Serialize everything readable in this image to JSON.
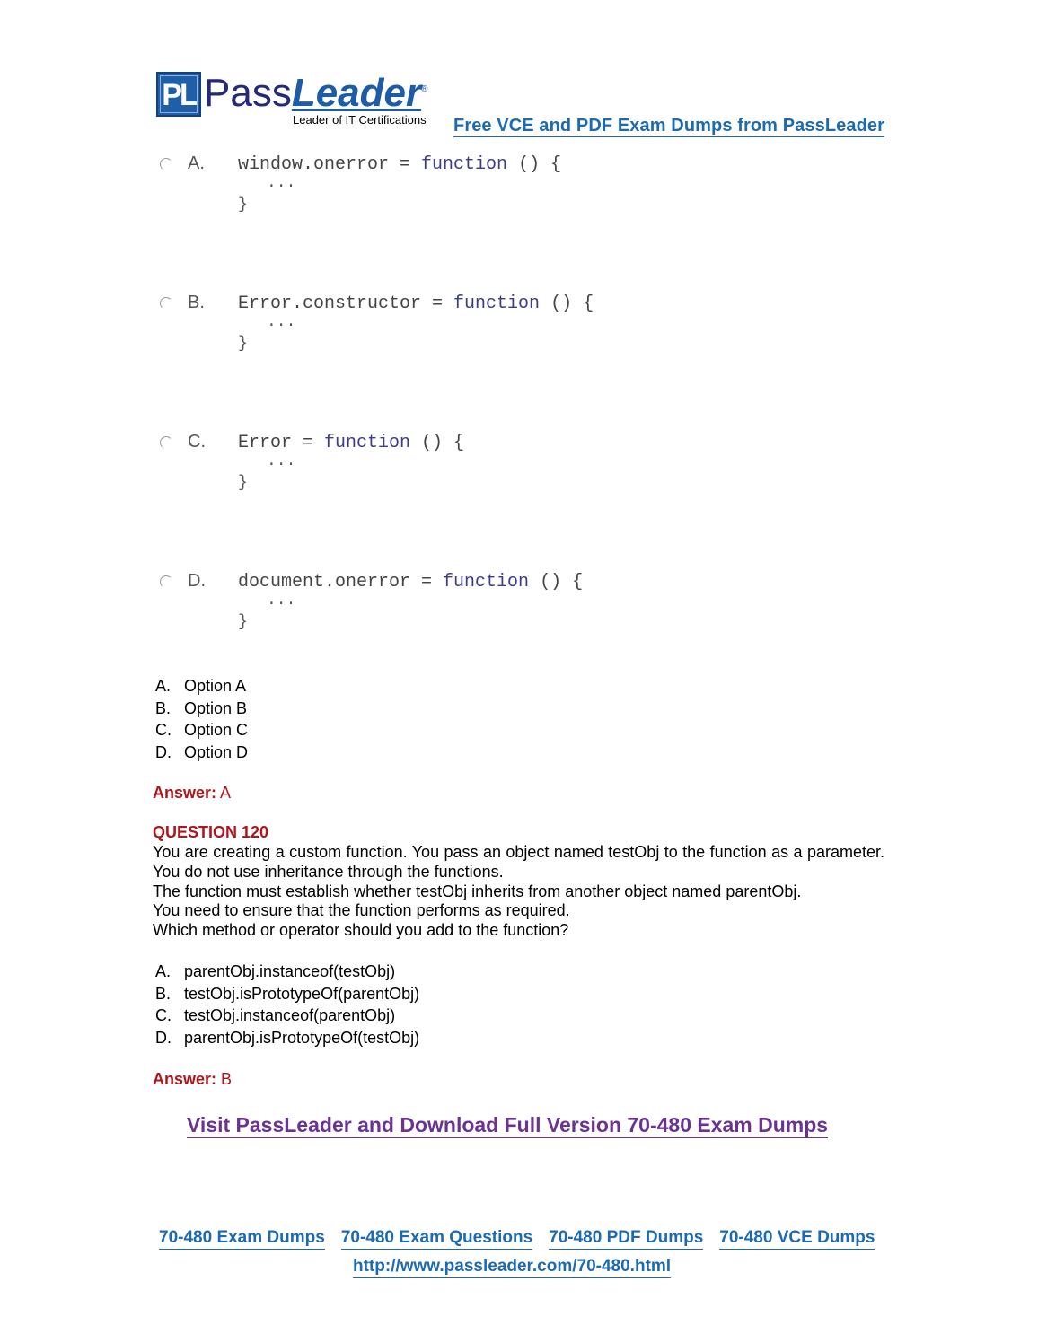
{
  "header": {
    "logo": {
      "box_text": "PL",
      "name_part1": "Pass",
      "name_part2": "Leader",
      "registered": "®",
      "tagline": "Leader of IT Certifications"
    },
    "top_link": "Free VCE and PDF Exam Dumps from PassLeader"
  },
  "question_119": {
    "code_options": [
      {
        "letter": "A.",
        "code_prefix": "window.onerror = ",
        "keyword": "function",
        "code_suffix": " () {",
        "body": "...",
        "close": "}"
      },
      {
        "letter": "B.",
        "code_prefix": "Error.constructor = ",
        "keyword": "function",
        "code_suffix": " () {",
        "body": "...",
        "close": "}"
      },
      {
        "letter": "C.",
        "code_prefix": "Error = ",
        "keyword": "function",
        "code_suffix": " () {",
        "body": "...",
        "close": "}"
      },
      {
        "letter": "D.",
        "code_prefix": "document.onerror = ",
        "keyword": "function",
        "code_suffix": " () {",
        "body": "...",
        "close": "}"
      }
    ],
    "choices": [
      {
        "letter": "A.",
        "text": "Option A"
      },
      {
        "letter": "B.",
        "text": "Option B"
      },
      {
        "letter": "C.",
        "text": "Option C"
      },
      {
        "letter": "D.",
        "text": "Option D"
      }
    ],
    "answer_label": "Answer:",
    "answer_value": "A"
  },
  "question_120": {
    "title": "QUESTION 120",
    "paragraphs": [
      "You are creating a custom function. You pass an object named testObj to the function as a parameter. You do not use inheritance through the functions.",
      "The function must establish whether testObj inherits from another object named parentObj.",
      "You need to ensure that the function performs as required.",
      "Which method or operator should you add to the function?"
    ],
    "choices": [
      {
        "letter": "A.",
        "text": "parentObj.instanceof(testObj)"
      },
      {
        "letter": "B.",
        "text": "testObj.isPrototypeOf(parentObj)"
      },
      {
        "letter": "C.",
        "text": "testObj.instanceof(parentObj)"
      },
      {
        "letter": "D.",
        "text": "parentObj.isPrototypeOf(testObj)"
      }
    ],
    "answer_label": "Answer:",
    "answer_value": "B"
  },
  "footer": {
    "visit_link": "Visit PassLeader and Download Full Version 70-480 Exam Dumps",
    "links": [
      "70-480 Exam Dumps",
      "70-480 Exam Questions",
      "70-480 PDF Dumps",
      "70-480 VCE Dumps"
    ],
    "url": "http://www.passleader.com/70-480.html"
  },
  "colors": {
    "brand_blue": "#1c6ab3",
    "answer_red": "#b0151c",
    "visit_purple": "#6b3294",
    "code_keyword": "#3b3d8a"
  }
}
